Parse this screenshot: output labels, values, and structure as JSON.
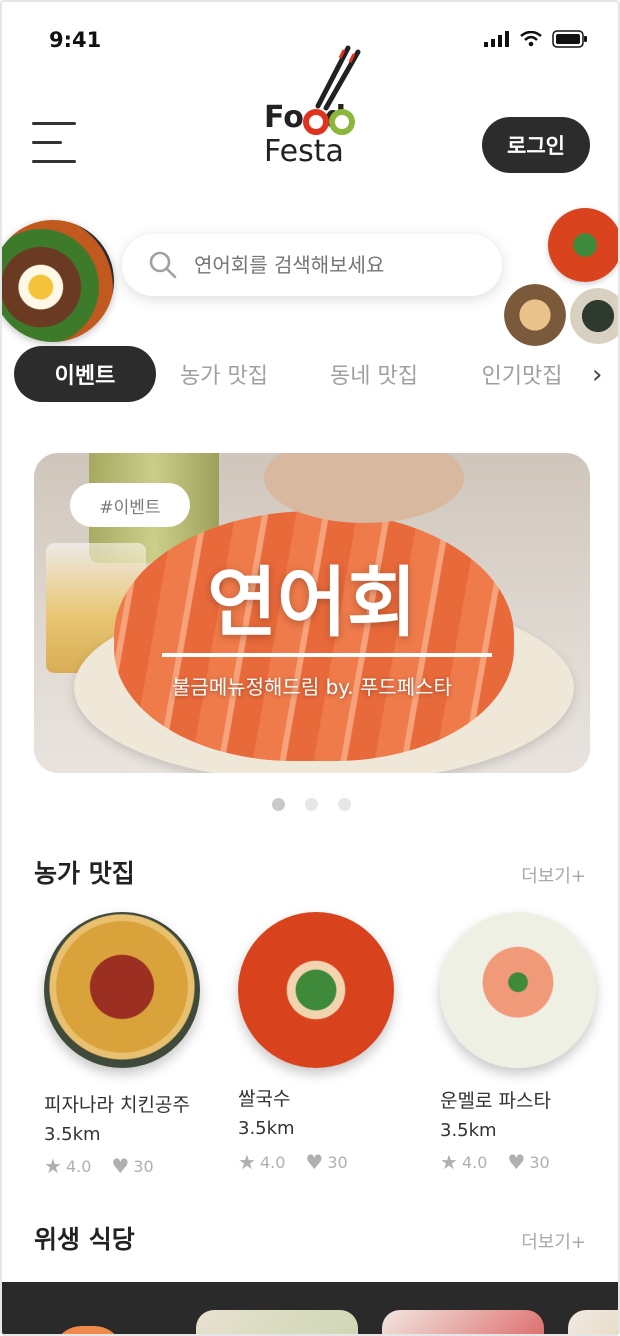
{
  "status_bar": {
    "time": "9:41"
  },
  "header": {
    "logo_line1": "Food",
    "logo_line2": "Festa",
    "login_label": "로그인"
  },
  "search": {
    "placeholder": "연어회를 검색해보세요"
  },
  "tabs": [
    {
      "label": "이벤트",
      "active": true
    },
    {
      "label": "농가 맛집",
      "active": false
    },
    {
      "label": "동네 맛집",
      "active": false
    },
    {
      "label": "인기맛집",
      "active": false
    }
  ],
  "banner": {
    "tag": "#이벤트",
    "title": "연어회",
    "subtitle": "불금메뉴정해드림 by. 푸드페스타",
    "slide_count": 3,
    "active_slide": 1
  },
  "farm_section": {
    "title": "농가 맛집",
    "more": "더보기+",
    "items": [
      {
        "name": "피자나라 치킨공주",
        "distance": "3.5km",
        "rating": "4.0",
        "likes": "30"
      },
      {
        "name": "쌀국수",
        "distance": "3.5km",
        "rating": "4.0",
        "likes": "30"
      },
      {
        "name": "운멜로 파스타",
        "distance": "3.5km",
        "rating": "4.0",
        "likes": "30"
      }
    ]
  },
  "hygiene_section": {
    "title": "위생 식당",
    "more": "더보기+"
  },
  "colors": {
    "dark": "#2c2c2c",
    "muted": "#a9a9a9",
    "logo_red": "#e0321f",
    "logo_green": "#8bb83a",
    "logo_orange": "#f09a1a"
  }
}
